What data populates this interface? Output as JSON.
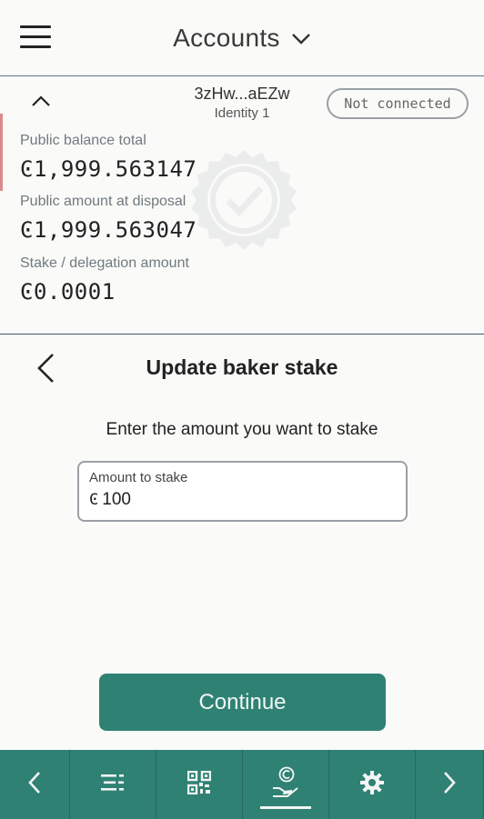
{
  "header": {
    "title": "Accounts"
  },
  "account": {
    "address": "3zHw...aEZw",
    "identity": "Identity 1",
    "status": "Not connected",
    "public_balance_label": "Public balance total",
    "public_balance": "Ͼ1,999.563147",
    "at_disposal_label": "Public amount at disposal",
    "at_disposal": "Ͼ1,999.563047",
    "stake_label": "Stake / delegation amount",
    "stake": "Ͼ0.0001"
  },
  "page": {
    "title": "Update baker stake",
    "instruction": "Enter the amount you want to stake"
  },
  "amount_input": {
    "label": "Amount to stake",
    "currency": "Ͼ",
    "value": "100"
  },
  "continue_label": "Continue",
  "nav": {
    "items": [
      "back-arrow-icon",
      "list-icon",
      "qr-code-icon",
      "baker-stake-icon",
      "gear-icon",
      "forward-arrow-icon"
    ],
    "active": "baker-stake-icon"
  },
  "colors": {
    "accent": "#2f8273",
    "background": "#fafaf8",
    "divider": "#3b5a68"
  }
}
